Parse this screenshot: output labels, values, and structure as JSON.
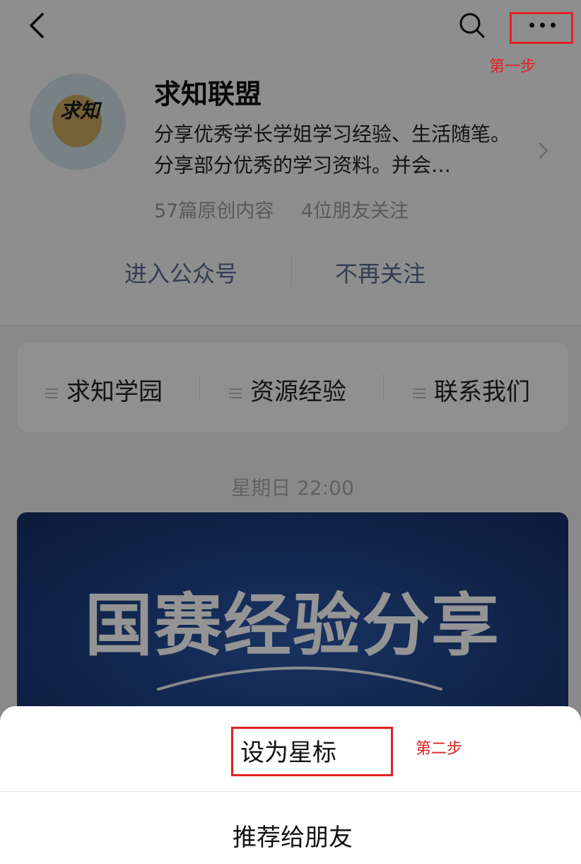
{
  "header": {
    "back_icon": "chevron-left-icon",
    "search_icon": "search-icon",
    "more_icon": "more-dots-icon"
  },
  "account": {
    "avatar_text": "求知",
    "name": "求知联盟",
    "description": "分享优秀学长学姐学习经验、生活随笔。分享部分优秀的学习资料。并会…",
    "original_count": "57篇原创内容",
    "friends_following": "4位朋友关注"
  },
  "actions": {
    "enter": "进入公众号",
    "unfollow": "不再关注"
  },
  "menu": {
    "items": [
      {
        "label": "求知学园"
      },
      {
        "label": "资源经验"
      },
      {
        "label": "联系我们"
      }
    ]
  },
  "feed": {
    "timestamp": "星期日 22:00",
    "banner_title": "国赛经验分享"
  },
  "sheet": {
    "option_star": "设为星标",
    "option_recommend": "推荐给朋友"
  },
  "annotations": {
    "step1": "第一步",
    "step2": "第二步",
    "color": "#e02222"
  },
  "colors": {
    "link": "#596a8f",
    "banner": "#1e3e7c",
    "background": "#ededed"
  }
}
